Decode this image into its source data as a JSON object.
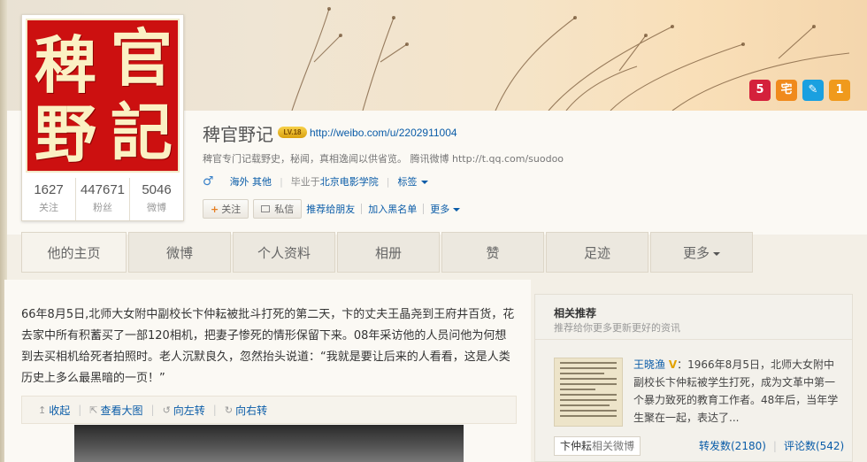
{
  "profile": {
    "avatar_chars": [
      "官",
      "稗",
      "記",
      "野"
    ],
    "stats": [
      {
        "num": "1627",
        "label": "关注"
      },
      {
        "num": "447671",
        "label": "粉丝"
      },
      {
        "num": "5046",
        "label": "微博"
      }
    ],
    "name": "稗官野记",
    "level_badge": "LV.18",
    "url": "http://weibo.com/u/2202911004",
    "intro": "稗官专门记载野史，秘闻，真相逸闻以供省览。 腾讯微博 http://t.qq.com/suodoo",
    "gender_symbol": "♂",
    "location": "海外 其他",
    "edu_prefix": "毕业于",
    "school": "北京电影学院",
    "tags_label": "标签"
  },
  "top_icons": [
    {
      "name": "download-icon",
      "glyph": "5",
      "color": "#d4213b"
    },
    {
      "name": "home-icon",
      "glyph": "宅",
      "color": "#f08a1c"
    },
    {
      "name": "app-icon",
      "glyph": "✎",
      "color": "#1aa0e0"
    },
    {
      "name": "medal-icon",
      "glyph": "1",
      "color": "#f09a1c"
    }
  ],
  "actions": {
    "follow": "关注",
    "message": "私信",
    "recommend": "推荐给朋友",
    "blacklist": "加入黑名单",
    "more": "更多"
  },
  "tabs": [
    "他的主页",
    "微博",
    "个人资料",
    "相册",
    "赞",
    "足迹",
    "更多"
  ],
  "post": {
    "text": "66年8月5日,北师大女附中副校长卞仲耘被批斗打死的第二天，卞的丈夫王晶尧到王府井百货，花去家中所有积蓄买了一部120相机，把妻子惨死的情形保留下来。08年采访他的人员问他为何想到去买相机给死者拍照时。老人沉默良久，忽然抬头说道：“我就是要让后来的人看看，这是人类历史上多么最黑暗的一页！”",
    "toolbar": [
      "收起",
      "查看大图",
      "向左转",
      "向右转"
    ]
  },
  "side": {
    "title": "相关推荐",
    "subtitle": "推荐给你更多更新更好的资讯",
    "rec_name": "王晓渔",
    "rec_badge": "V",
    "rec_text": "：1966年8月5日，北师大女附中副校长卞仲耘被学生打死，成为文革中第一个暴力致死的教育工作者。48年后，当年学生聚在一起，表达了...",
    "tag_main": "卞仲耘",
    "tag_sub": "相关微博",
    "reposts": "转发数(2180)",
    "comments": "评论数(542)"
  }
}
